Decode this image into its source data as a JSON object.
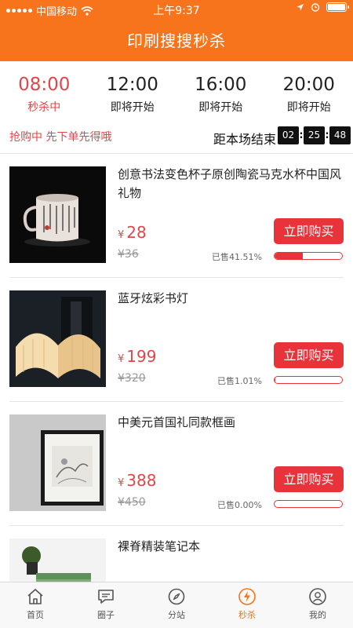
{
  "status_bar": {
    "carrier": "中国移动",
    "time": "上午9:37"
  },
  "header": {
    "title": "印刷搜搜秒杀"
  },
  "colors": {
    "brand": "#f7731c",
    "accent": "#e8333b"
  },
  "time_slots": [
    {
      "time": "08:00",
      "status": "秒杀中",
      "active": true
    },
    {
      "time": "12:00",
      "status": "即将开始",
      "active": false
    },
    {
      "time": "16:00",
      "status": "即将开始",
      "active": false
    },
    {
      "time": "20:00",
      "status": "即将开始",
      "active": false
    }
  ],
  "info": {
    "hint": "抢购中 先下单先得哦",
    "countdown_label": "距本场结束",
    "countdown": {
      "hours": "02",
      "minutes": "25",
      "seconds": "48"
    }
  },
  "products": [
    {
      "name": "创意书法变色杯子原创陶瓷马克水杯中国风礼物",
      "currency": "¥",
      "price": "28",
      "old_price": "¥36",
      "sold_label": "已售41.51%",
      "sold_fraction": 0.4151,
      "buy_label": "立即购买",
      "image": "calligraphy-mug-image"
    },
    {
      "name": "蓝牙炫彩书灯",
      "currency": "¥",
      "price": "199",
      "old_price": "¥320",
      "sold_label": "已售1.01%",
      "sold_fraction": 0.0101,
      "buy_label": "立即购买",
      "image": "book-lamp-image"
    },
    {
      "name": "中美元首国礼同款框画",
      "currency": "¥",
      "price": "388",
      "old_price": "¥450",
      "sold_label": "已售0.00%",
      "sold_fraction": 0.0,
      "buy_label": "立即购买",
      "image": "framed-painting-image"
    },
    {
      "name": "裸脊精装笔记本",
      "image": "notebook-image"
    }
  ],
  "tabbar": [
    {
      "label": "首页",
      "icon": "home-icon"
    },
    {
      "label": "圈子",
      "icon": "chat-icon"
    },
    {
      "label": "分站",
      "icon": "compass-icon"
    },
    {
      "label": "秒杀",
      "icon": "lightning-icon",
      "active": true
    },
    {
      "label": "我的",
      "icon": "user-icon"
    }
  ]
}
